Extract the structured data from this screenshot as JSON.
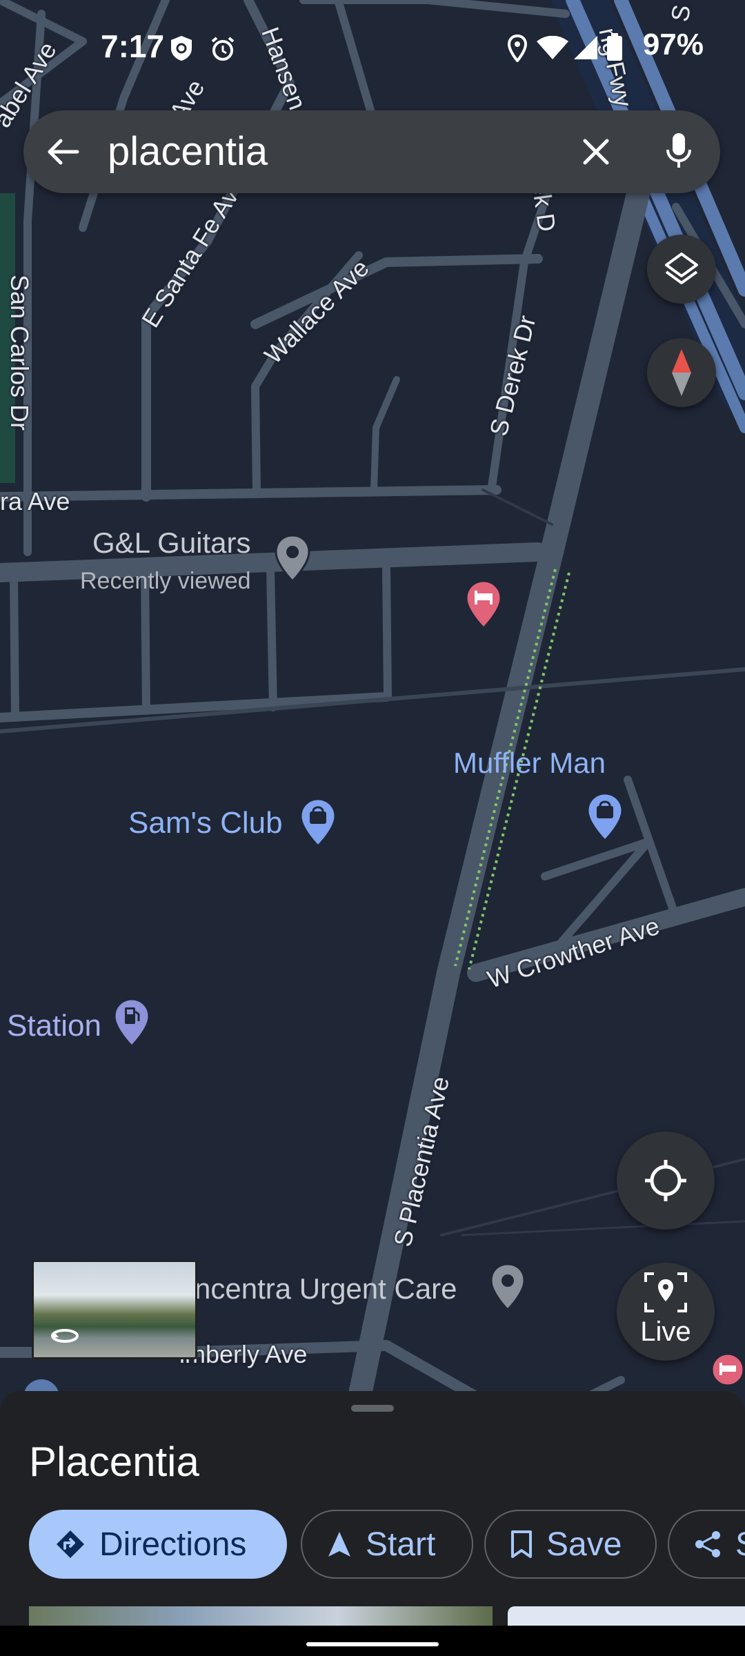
{
  "status_bar": {
    "time": "7:17",
    "battery": "97%"
  },
  "search": {
    "query": "placentia"
  },
  "map": {
    "streets": {
      "e_santa_fe": "E Santa Fe Ave",
      "wallace": "Wallace Ave",
      "s_derek_dr": "S Derek Dr",
      "s_derek_top": "S Derek D",
      "san_carlos": "San Carlos Dr",
      "ra_ave": "ra Ave",
      "hansen": "Hansen",
      "abel_ave": "abel Ave",
      "top_ave": "Ave",
      "w_crowther": "W Crowther Ave",
      "s_placentia": "S Placentia Ave",
      "kimberly": "imberly Ave",
      "fwy": "ng Fwy",
      "s_placen": "S Placen"
    },
    "places": {
      "gl_guitars": "G&L Guitars",
      "gl_sub": "Recently viewed",
      "sams_club": "Sam's Club",
      "muffler_man": "Muffler Man",
      "station": "Station",
      "urgent_care": "ncentra Urgent Care"
    },
    "live_label": "Live"
  },
  "sheet": {
    "title": "Placentia",
    "actions": {
      "directions": "Directions",
      "start": "Start",
      "save": "Save",
      "share": "S"
    }
  },
  "colors": {
    "map_bg": "#1f2636",
    "road": "#4a5768",
    "highway": "#5b7baf",
    "accent": "#a8c7fa",
    "shopping_pin": "#7ea2ef",
    "hotel_pin": "#e0637a"
  },
  "icons": [
    "back-arrow-icon",
    "clear-icon",
    "mic-icon",
    "layers-icon",
    "compass-icon",
    "my-location-icon",
    "live-view-icon",
    "directions-icon",
    "navigation-icon",
    "bookmark-icon",
    "share-icon"
  ]
}
